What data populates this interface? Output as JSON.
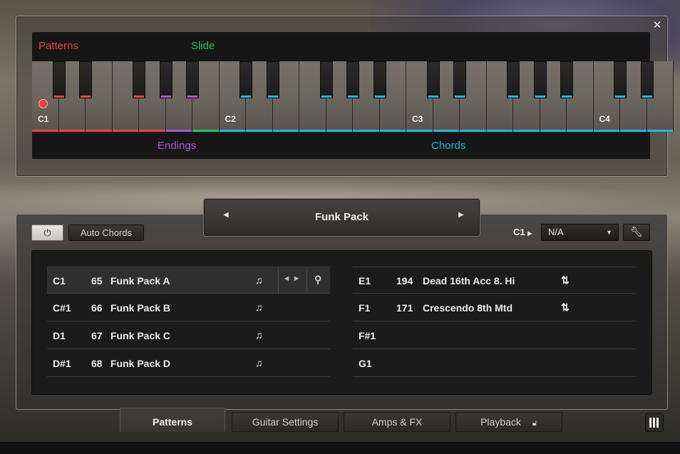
{
  "keyboard": {
    "zones": {
      "patterns": {
        "label": "Patterns",
        "color": "#e8473e"
      },
      "slide": {
        "label": "Slide",
        "color": "#29c46a"
      },
      "endings": {
        "label": "Endings",
        "color": "#b451d6"
      },
      "chords": {
        "label": "Chords",
        "color": "#23b5e0"
      }
    },
    "octave_labels": [
      "C1",
      "C2",
      "C3",
      "C4"
    ]
  },
  "preset": {
    "name": "Funk Pack"
  },
  "controls": {
    "auto_chords": "Auto Chords",
    "key_label": "C1",
    "key_select_value": "N/A"
  },
  "patterns_left": [
    {
      "key": "C1",
      "num": "65",
      "name": "Funk Pack A",
      "icon": "note-icon",
      "selected": true
    },
    {
      "key": "C#1",
      "num": "66",
      "name": "Funk Pack B",
      "icon": "note-icon"
    },
    {
      "key": "D1",
      "num": "67",
      "name": "Funk Pack C",
      "icon": "note-icon"
    },
    {
      "key": "D#1",
      "num": "68",
      "name": "Funk Pack D",
      "icon": "note-icon"
    }
  ],
  "patterns_right": [
    {
      "key": "E1",
      "num": "194",
      "name": "Dead 16th Acc 8. Hi",
      "icon": "updown-arrows-icon"
    },
    {
      "key": "F1",
      "num": "171",
      "name": "Crescendo 8th Mtd",
      "icon": "updown-arrows-icon"
    },
    {
      "key": "F#1",
      "num": "",
      "name": ""
    },
    {
      "key": "G1",
      "num": "",
      "name": ""
    }
  ],
  "tabs": [
    {
      "label": "Patterns",
      "active": true
    },
    {
      "label": "Guitar Settings"
    },
    {
      "label": "Amps & FX"
    },
    {
      "label": "Playback"
    }
  ]
}
